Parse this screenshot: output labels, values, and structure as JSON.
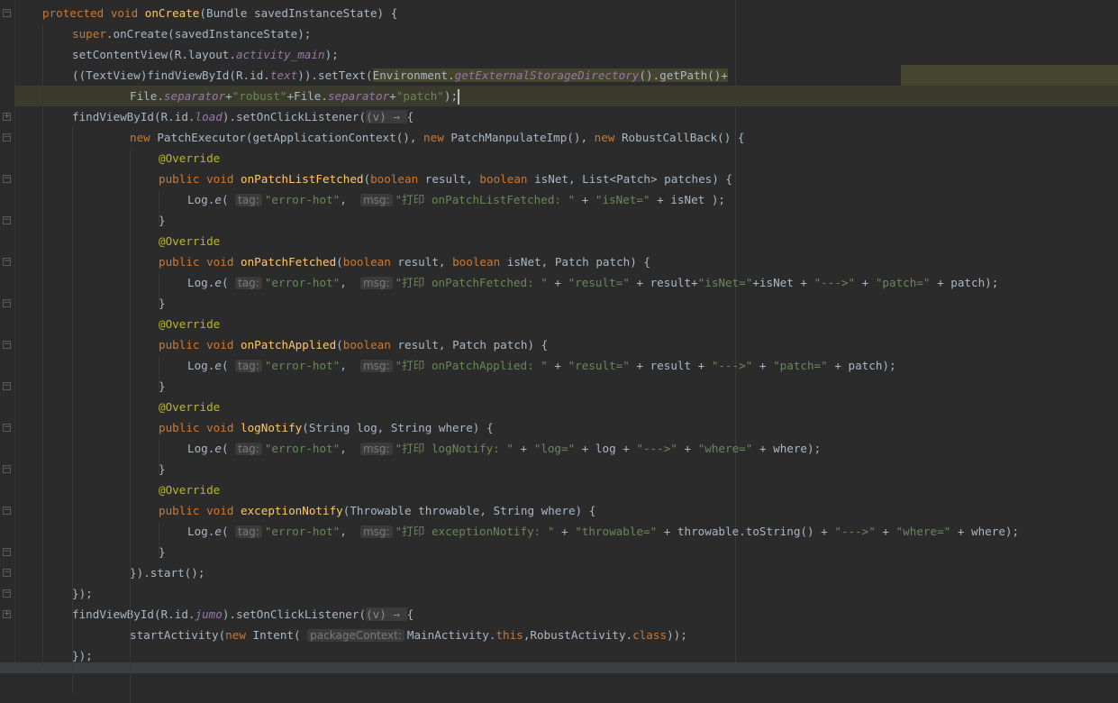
{
  "editor": {
    "colors": {
      "background": "#2b2b2b",
      "keyword": "#cc7832",
      "method": "#ffc66d",
      "string": "#6a8759",
      "field": "#9876aa",
      "annotation": "#bbb529",
      "text": "#a9b7c6"
    },
    "lines": [
      [
        [
          "kw",
          "protected void "
        ],
        [
          "fn",
          "onCreate"
        ],
        [
          "p",
          "(Bundle savedInstanceState) {"
        ]
      ],
      [
        [
          "kw",
          "super"
        ],
        [
          "p",
          ".onCreate(savedInstanceState);"
        ]
      ],
      [
        [
          "p",
          "setContentView(R.layout."
        ],
        [
          "field",
          "activity_main"
        ],
        [
          "p",
          ");"
        ]
      ],
      [
        [
          "p",
          "((TextView)findViewById(R.id."
        ],
        [
          "field",
          "text"
        ],
        [
          "p",
          ")).setText("
        ],
        [
          "hlp",
          "Environment."
        ],
        [
          "hlital",
          "getExternalStorageDirectory"
        ],
        [
          "hlp",
          "().getPath()+"
        ]
      ],
      [
        [
          "p",
          "File."
        ],
        [
          "field",
          "separator"
        ],
        [
          "p",
          "+"
        ],
        [
          "str",
          "\"robust\""
        ],
        [
          "p",
          "+File."
        ],
        [
          "field",
          "separator"
        ],
        [
          "p",
          "+"
        ],
        [
          "str",
          "\"patch\""
        ],
        [
          "p",
          ");"
        ],
        [
          "caret",
          ""
        ]
      ],
      [
        [
          "p",
          "findViewById(R.id."
        ],
        [
          "field",
          "load"
        ],
        [
          "p",
          ").setOnClickListener("
        ],
        [
          "lparam",
          "(v) → "
        ],
        [
          "p",
          "{"
        ]
      ],
      [
        [
          "kw",
          "new "
        ],
        [
          "p",
          "PatchExecutor(getApplicationContext(), "
        ],
        [
          "kw",
          "new "
        ],
        [
          "p",
          "PatchManpulateImp(), "
        ],
        [
          "kw",
          "new "
        ],
        [
          "p",
          "RobustCallBack() {"
        ]
      ],
      [
        [
          "ann",
          "@Override"
        ]
      ],
      [
        [
          "kw",
          "public void "
        ],
        [
          "fn",
          "onPatchListFetched"
        ],
        [
          "p",
          "("
        ],
        [
          "kw",
          "boolean "
        ],
        [
          "p",
          "result, "
        ],
        [
          "kw",
          "boolean "
        ],
        [
          "p",
          "isNet, List<Patch> patches) {"
        ]
      ],
      [
        [
          "p",
          "Log."
        ],
        [
          "ital",
          "e"
        ],
        [
          "p",
          "( "
        ],
        [
          "hint",
          "tag:"
        ],
        [
          "str",
          "\"error-hot\""
        ],
        [
          "p",
          ",  "
        ],
        [
          "hint",
          "msg:"
        ],
        [
          "str",
          "\"打印 onPatchListFetched: \""
        ],
        [
          "p",
          " + "
        ],
        [
          "str",
          "\"isNet=\""
        ],
        [
          "p",
          " + isNet );"
        ]
      ],
      [
        [
          "p",
          "}"
        ]
      ],
      [
        [
          "ann",
          "@Override"
        ]
      ],
      [
        [
          "kw",
          "public void "
        ],
        [
          "fn",
          "onPatchFetched"
        ],
        [
          "p",
          "("
        ],
        [
          "kw",
          "boolean "
        ],
        [
          "p",
          "result, "
        ],
        [
          "kw",
          "boolean "
        ],
        [
          "p",
          "isNet, Patch patch) {"
        ]
      ],
      [
        [
          "p",
          "Log."
        ],
        [
          "ital",
          "e"
        ],
        [
          "p",
          "( "
        ],
        [
          "hint",
          "tag:"
        ],
        [
          "str",
          "\"error-hot\""
        ],
        [
          "p",
          ",  "
        ],
        [
          "hint",
          "msg:"
        ],
        [
          "str",
          "\"打印 onPatchFetched: \""
        ],
        [
          "p",
          " + "
        ],
        [
          "str",
          "\"result=\""
        ],
        [
          "p",
          " + result+"
        ],
        [
          "str",
          "\"isNet=\""
        ],
        [
          "p",
          "+isNet + "
        ],
        [
          "str",
          "\"--->\""
        ],
        [
          "p",
          " + "
        ],
        [
          "str",
          "\"patch=\""
        ],
        [
          "p",
          " + patch);"
        ]
      ],
      [
        [
          "p",
          "}"
        ]
      ],
      [
        [
          "ann",
          "@Override"
        ]
      ],
      [
        [
          "kw",
          "public void "
        ],
        [
          "fn",
          "onPatchApplied"
        ],
        [
          "p",
          "("
        ],
        [
          "kw",
          "boolean "
        ],
        [
          "p",
          "result, Patch patch) {"
        ]
      ],
      [
        [
          "p",
          "Log."
        ],
        [
          "ital",
          "e"
        ],
        [
          "p",
          "( "
        ],
        [
          "hint",
          "tag:"
        ],
        [
          "str",
          "\"error-hot\""
        ],
        [
          "p",
          ",  "
        ],
        [
          "hint",
          "msg:"
        ],
        [
          "str",
          "\"打印 onPatchApplied: \""
        ],
        [
          "p",
          " + "
        ],
        [
          "str",
          "\"result=\""
        ],
        [
          "p",
          " + result + "
        ],
        [
          "str",
          "\"--->\""
        ],
        [
          "p",
          " + "
        ],
        [
          "str",
          "\"patch=\""
        ],
        [
          "p",
          " + patch);"
        ]
      ],
      [
        [
          "p",
          "}"
        ]
      ],
      [
        [
          "ann",
          "@Override"
        ]
      ],
      [
        [
          "kw",
          "public void "
        ],
        [
          "fn",
          "logNotify"
        ],
        [
          "p",
          "(String log, String where) {"
        ]
      ],
      [
        [
          "p",
          "Log."
        ],
        [
          "ital",
          "e"
        ],
        [
          "p",
          "( "
        ],
        [
          "hint",
          "tag:"
        ],
        [
          "str",
          "\"error-hot\""
        ],
        [
          "p",
          ",  "
        ],
        [
          "hint",
          "msg:"
        ],
        [
          "str",
          "\"打印 logNotify: \""
        ],
        [
          "p",
          " + "
        ],
        [
          "str",
          "\"log=\""
        ],
        [
          "p",
          " + log + "
        ],
        [
          "str",
          "\"--->\""
        ],
        [
          "p",
          " + "
        ],
        [
          "str",
          "\"where=\""
        ],
        [
          "p",
          " + where);"
        ]
      ],
      [
        [
          "p",
          "}"
        ]
      ],
      [
        [
          "ann",
          "@Override"
        ]
      ],
      [
        [
          "kw",
          "public void "
        ],
        [
          "fn",
          "exceptionNotify"
        ],
        [
          "p",
          "(Throwable throwable, String where) {"
        ]
      ],
      [
        [
          "p",
          "Log."
        ],
        [
          "ital",
          "e"
        ],
        [
          "p",
          "( "
        ],
        [
          "hint",
          "tag:"
        ],
        [
          "str",
          "\"error-hot\""
        ],
        [
          "p",
          ",  "
        ],
        [
          "hint",
          "msg:"
        ],
        [
          "str",
          "\"打印 exceptionNotify: \""
        ],
        [
          "p",
          " + "
        ],
        [
          "str",
          "\"throwable=\""
        ],
        [
          "p",
          " + throwable.toString() + "
        ],
        [
          "str",
          "\"--->\""
        ],
        [
          "p",
          " + "
        ],
        [
          "str",
          "\"where=\""
        ],
        [
          "p",
          " + where);"
        ]
      ],
      [
        [
          "p",
          "}"
        ]
      ],
      [
        [
          "p",
          "}).start();"
        ]
      ],
      [
        [
          "p",
          "});"
        ]
      ],
      [
        [
          "p",
          "findViewById(R.id."
        ],
        [
          "field",
          "jumo"
        ],
        [
          "p",
          ").setOnClickListener("
        ],
        [
          "lparam",
          "(v) → "
        ],
        [
          "p",
          "{"
        ]
      ],
      [
        [
          "p",
          "startActivity("
        ],
        [
          "kw",
          "new "
        ],
        [
          "p",
          "Intent( "
        ],
        [
          "hint",
          "packageContext:"
        ],
        [
          "p",
          "MainActivity."
        ],
        [
          "kw",
          "this"
        ],
        [
          "p",
          ",RobustActivity."
        ],
        [
          "kw",
          "class"
        ],
        [
          "p",
          "));"
        ]
      ],
      [
        [
          "p",
          "});"
        ]
      ]
    ]
  }
}
